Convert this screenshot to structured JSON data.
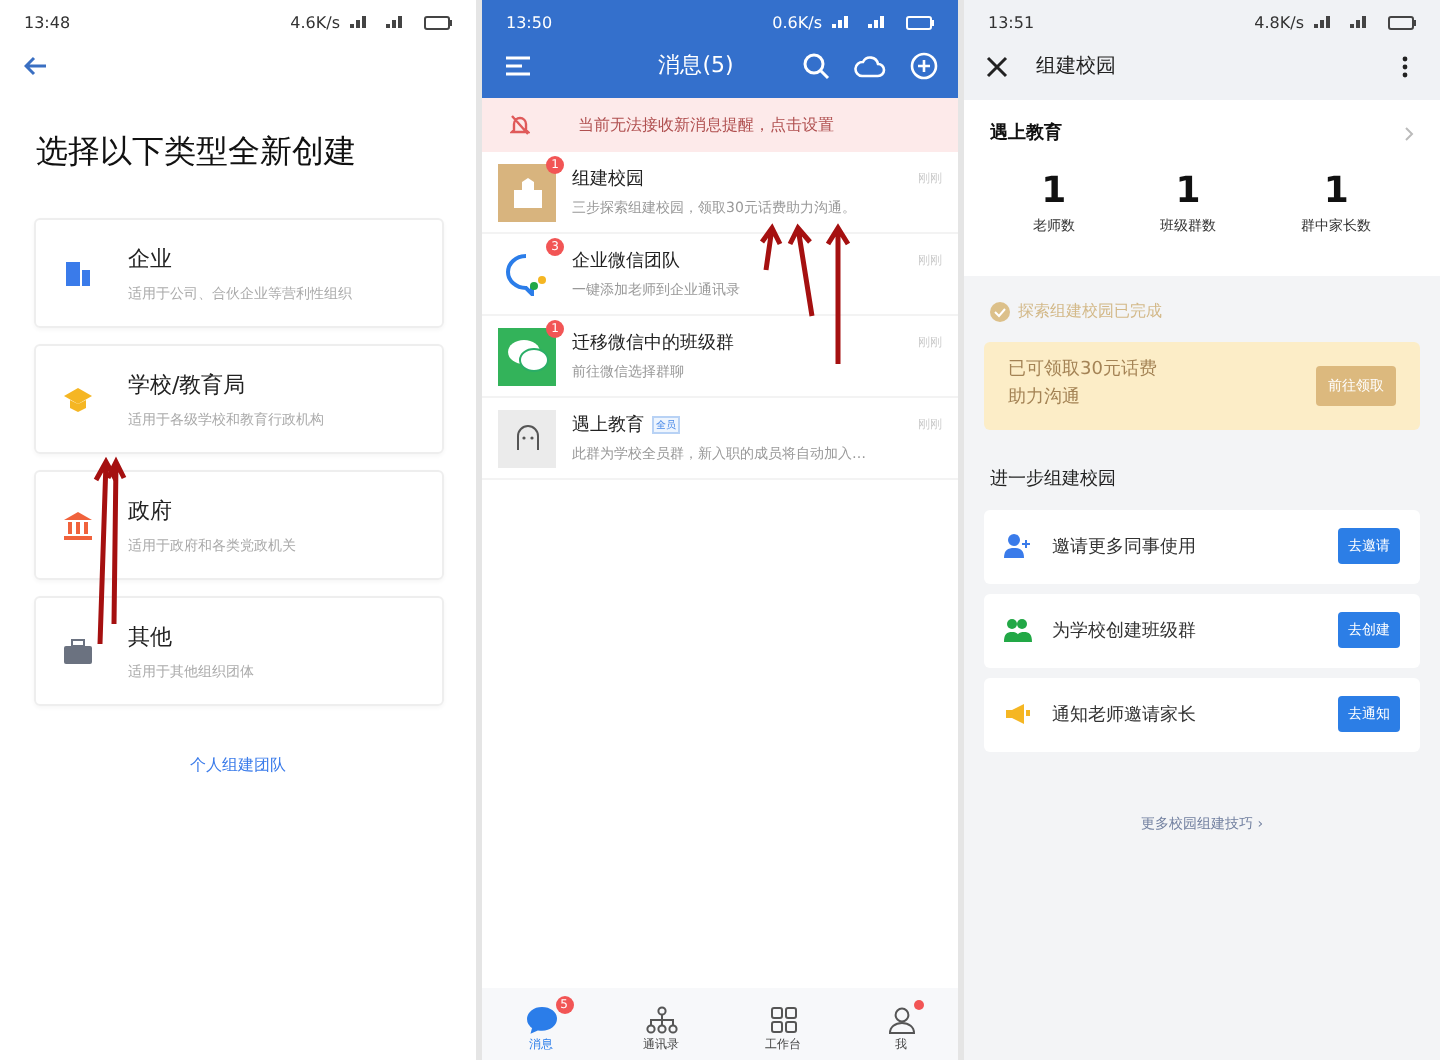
{
  "choose_type": {
    "status_bar": {
      "time": "13:48",
      "speed": "4.6K/s"
    },
    "title": "选择以下类型全新创建",
    "options": [
      {
        "kind": "enterprise",
        "name": "企业",
        "desc": "适用于公司、合伙企业等营利性组织"
      },
      {
        "kind": "school",
        "name": "学校/教育局",
        "desc": "适用于各级学校和教育行政机构"
      },
      {
        "kind": "government",
        "name": "政府",
        "desc": "适用于政府和各类党政机关"
      },
      {
        "kind": "other",
        "name": "其他",
        "desc": "适用于其他组织团体"
      }
    ],
    "link": "个人组建团队"
  },
  "messages": {
    "status_bar": {
      "time": "13:50",
      "speed": "0.6K/s"
    },
    "title": "消息(5)",
    "banner": "当前无法接收新消息提醒，点击设置",
    "chats": [
      {
        "kind": "school",
        "name": "组建校园",
        "badge": "1",
        "preview": "三步探索组建校园，领取30元话费助力沟通。",
        "time": "刚刚"
      },
      {
        "kind": "team",
        "name": "企业微信团队",
        "badge": "3",
        "preview": "一键添加老师到企业通讯录",
        "time": "刚刚"
      },
      {
        "kind": "wechat",
        "name": "迁移微信中的班级群",
        "badge": "1",
        "preview": "前往微信选择群聊",
        "time": "刚刚"
      },
      {
        "kind": "group",
        "name": "遇上教育",
        "tag": "全员",
        "preview": "此群为学校全员群，新入职的成员将自动加入…",
        "time": "刚刚"
      }
    ],
    "nav": [
      {
        "kind": "chat",
        "label": "消息",
        "selected": true,
        "badge": "5"
      },
      {
        "kind": "contacts",
        "label": "通讯录",
        "selected": false
      },
      {
        "kind": "workbench",
        "label": "工作台",
        "selected": false
      },
      {
        "kind": "me",
        "label": "我",
        "selected": false,
        "dot": true
      }
    ]
  },
  "school_setup": {
    "status_bar": {
      "time": "13:51",
      "speed": "4.8K/s"
    },
    "title": "组建校园",
    "org": "遇上教育",
    "stats": [
      {
        "value": "1",
        "label": "老师数"
      },
      {
        "value": "1",
        "label": "班级群数"
      },
      {
        "value": "1",
        "label": "群中家长数"
      }
    ],
    "done": "探索组建校园已完成",
    "reward": {
      "lines": [
        "已可领取30元话费",
        "助力沟通"
      ],
      "button": "前往领取"
    },
    "section": "进一步组建校园",
    "actions": [
      {
        "kind": "invite",
        "text": "邀请更多同事使用",
        "button": "去邀请"
      },
      {
        "kind": "group",
        "text": "为学校创建班级群",
        "button": "去创建"
      },
      {
        "kind": "notify",
        "text": "通知老师邀请家长",
        "button": "去通知"
      }
    ],
    "link": "更多校园组建技巧 ›"
  }
}
